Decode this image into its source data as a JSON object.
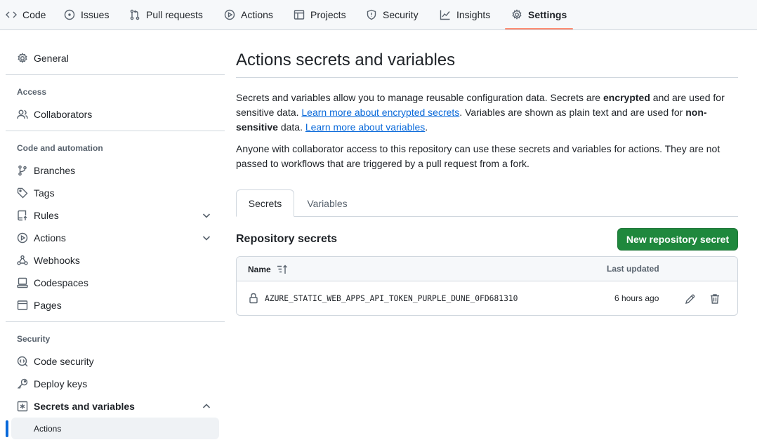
{
  "repo_nav": {
    "tabs": [
      {
        "label": "Code",
        "icon": "code-icon"
      },
      {
        "label": "Issues",
        "icon": "issue-icon"
      },
      {
        "label": "Pull requests",
        "icon": "pull-request-icon"
      },
      {
        "label": "Actions",
        "icon": "play-icon"
      },
      {
        "label": "Projects",
        "icon": "table-icon"
      },
      {
        "label": "Security",
        "icon": "shield-icon"
      },
      {
        "label": "Insights",
        "icon": "graph-icon"
      },
      {
        "label": "Settings",
        "icon": "gear-icon",
        "active": true
      }
    ],
    "underline_color": "#fd8c73"
  },
  "sidebar": {
    "general": "General",
    "access_heading": "Access",
    "collaborators": "Collaborators",
    "code_automation_heading": "Code and automation",
    "branches": "Branches",
    "tags": "Tags",
    "rules": "Rules",
    "actions": "Actions",
    "webhooks": "Webhooks",
    "codespaces": "Codespaces",
    "pages": "Pages",
    "security_heading": "Security",
    "code_security": "Code security",
    "deploy_keys": "Deploy keys",
    "secrets_variables": "Secrets and variables",
    "secrets_sub_actions": "Actions"
  },
  "main": {
    "title": "Actions secrets and variables",
    "intro": {
      "p1_a": "Secrets and variables allow you to manage reusable configuration data. Secrets are ",
      "p1_b": "encrypted",
      "p1_c": " and are used for sensitive data. ",
      "link_secrets": "Learn more about encrypted secrets",
      "p1_d": ". Variables are shown as plain text and are used for ",
      "p1_e": "non-sensitive",
      "p1_f": " data. ",
      "link_variables": "Learn more about variables",
      "p1_g": "."
    },
    "notice": "Anyone with collaborator access to this repository can use these secrets and variables for actions. They are not passed to workflows that are triggered by a pull request from a fork.",
    "tabs": {
      "secrets": "Secrets",
      "variables": "Variables"
    },
    "section_title": "Repository secrets",
    "new_button": "New repository secret",
    "table": {
      "col_name": "Name",
      "col_updated": "Last updated",
      "rows": [
        {
          "name": "AZURE_STATIC_WEB_APPS_API_TOKEN_PURPLE_DUNE_0FD681310",
          "updated": "6 hours ago"
        }
      ]
    }
  },
  "colors": {
    "primary_button": "#1f883d",
    "link": "#0969da",
    "border": "#d0d7de",
    "active_marker": "#0969da"
  }
}
